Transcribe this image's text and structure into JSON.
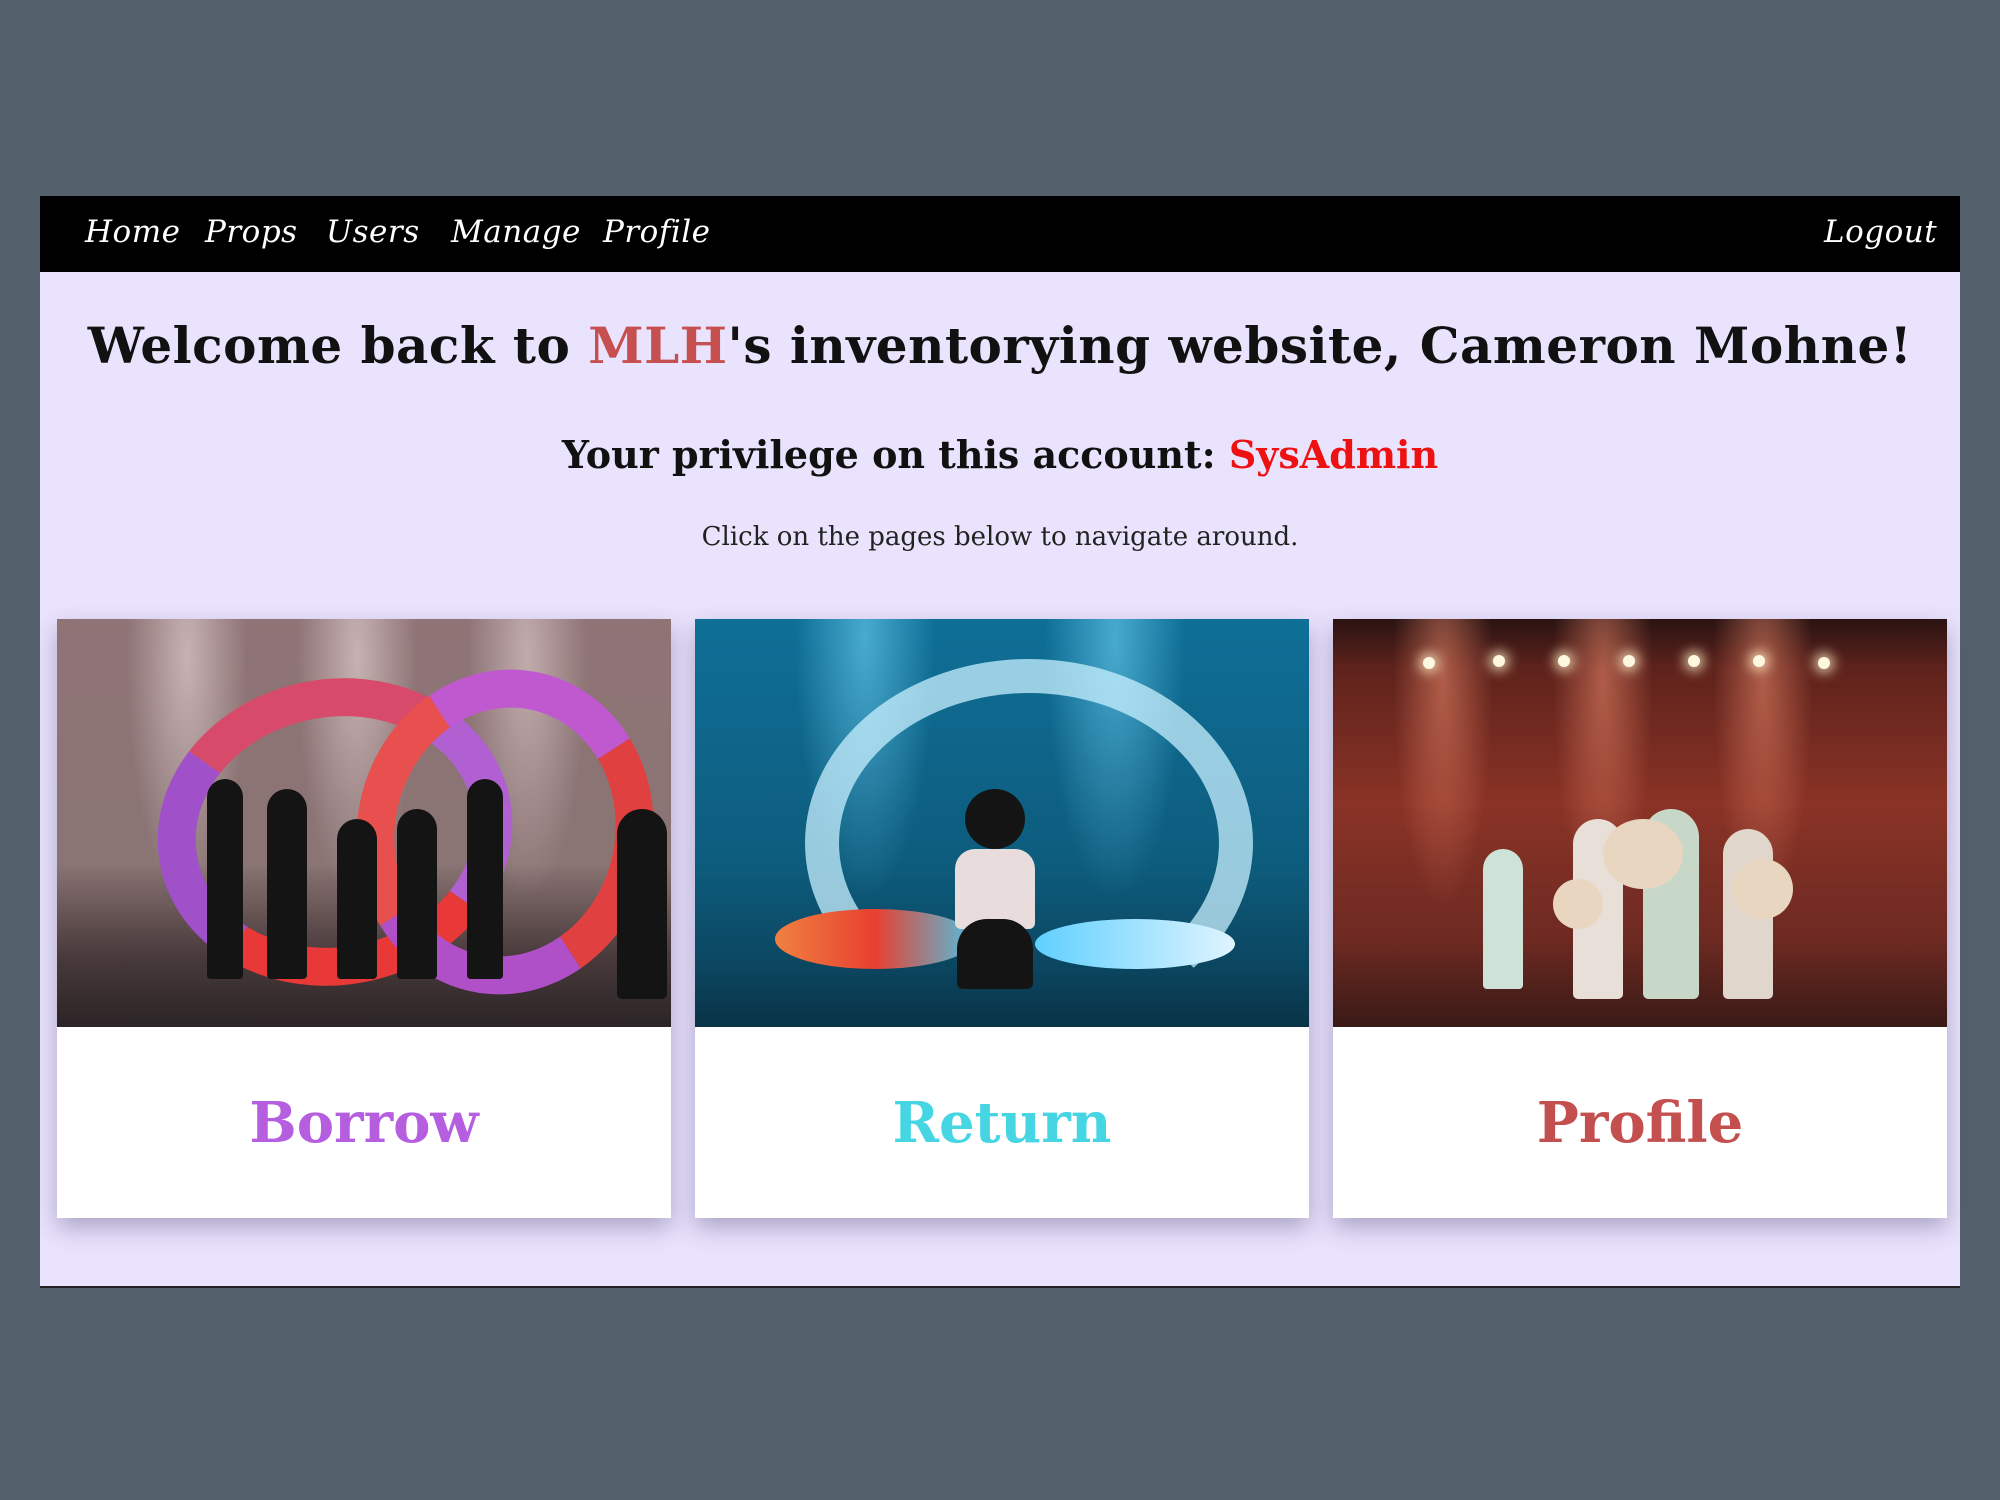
{
  "navbar": {
    "links": [
      {
        "label": "Home"
      },
      {
        "label": "Props"
      },
      {
        "label": "Users"
      },
      {
        "label": "Manage"
      },
      {
        "label": "Profile"
      }
    ],
    "logout_label": "Logout"
  },
  "welcome": {
    "prefix": "Welcome back to ",
    "org": "MLH",
    "suffix": "'s inventorying website,  Cameron Mohne!",
    "org_color": "#c65050"
  },
  "privilege": {
    "label": "Your privilege on this account: ",
    "role": "SysAdmin",
    "role_color": "#ee1111"
  },
  "hint": "Click on the pages below to navigate around.",
  "cards": [
    {
      "label": "Borrow",
      "color": "#b55fe0",
      "image": "dancers-with-fans-photo"
    },
    {
      "label": "Return",
      "color": "#45d5e3",
      "image": "dancer-with-silk-ribbons-photo"
    },
    {
      "label": "Profile",
      "color": "#c44f4f",
      "image": "dancers-with-hats-photo"
    }
  ]
}
